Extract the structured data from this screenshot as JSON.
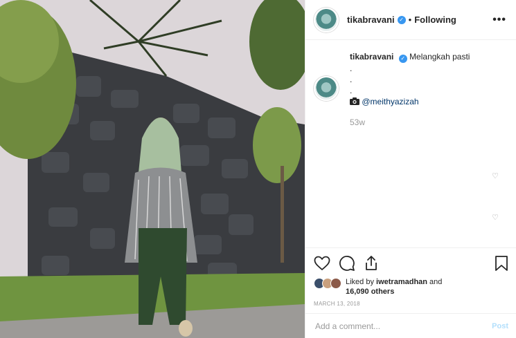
{
  "header": {
    "username": "tikabravani",
    "verified_mark": "✓",
    "separator": "•",
    "follow_status": "Following",
    "more_label": "•••"
  },
  "caption": {
    "username": "tikabravani",
    "text": "Melangkah pasti",
    "dots": [
      ".",
      ".",
      "."
    ],
    "camera_icon": "camera-icon",
    "mention": "@meithyazizah",
    "age": "53w"
  },
  "comment_likes": [
    "♡",
    "♡"
  ],
  "actions": {
    "icons": [
      "heart-icon",
      "comment-icon",
      "share-icon",
      "bookmark-icon"
    ]
  },
  "likes": {
    "prefix": "Liked by ",
    "user": "iwetramadhan",
    "middle": " and",
    "count": "16,090 others"
  },
  "date": "MARCH 13, 2018",
  "add_comment": {
    "placeholder": "Add a comment...",
    "post_label": "Post"
  },
  "colors": {
    "verified": "#3897f0",
    "post_disabled": "#b2dffc",
    "muted": "#999999",
    "text": "#262626"
  }
}
